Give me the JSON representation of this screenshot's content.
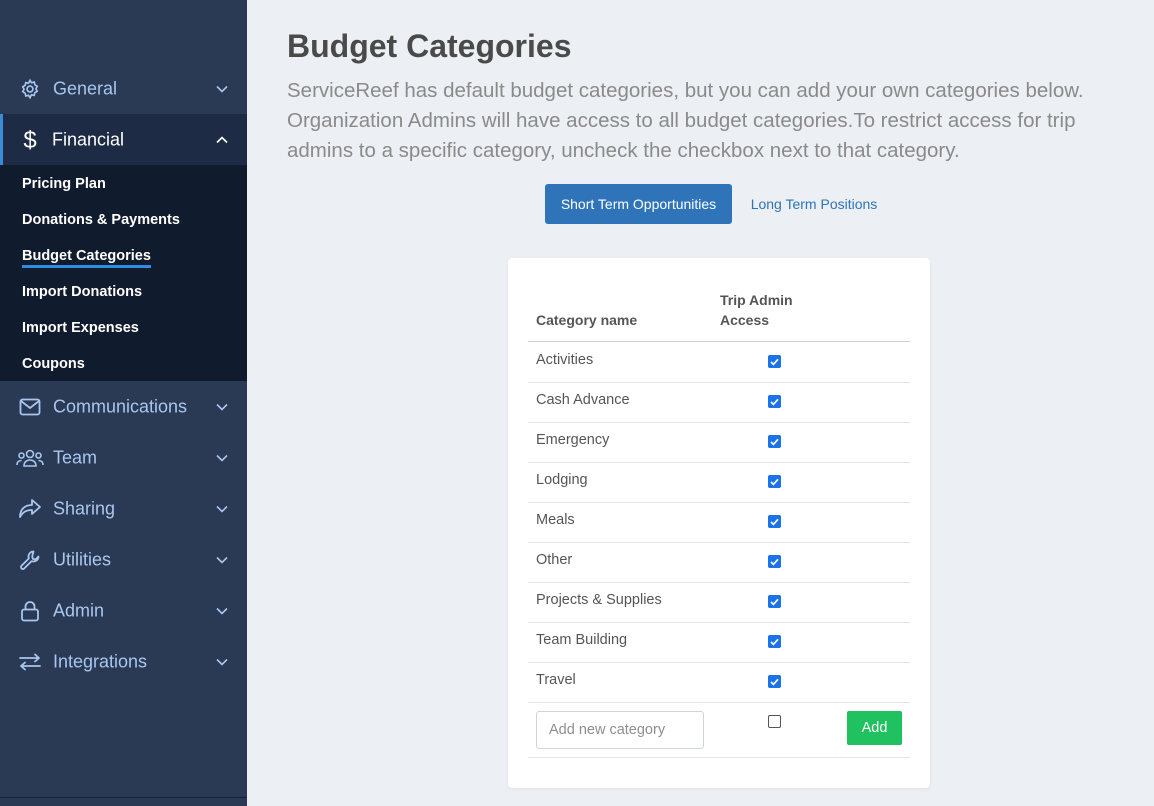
{
  "sidebar": {
    "nav": [
      {
        "key": "general",
        "label": "General",
        "icon": "gear-icon"
      },
      {
        "key": "financial",
        "label": "Financial",
        "icon": "dollar-icon"
      },
      {
        "key": "communications",
        "label": "Communications",
        "icon": "envelope-icon"
      },
      {
        "key": "team",
        "label": "Team",
        "icon": "users-icon"
      },
      {
        "key": "sharing",
        "label": "Sharing",
        "icon": "share-icon"
      },
      {
        "key": "utilities",
        "label": "Utilities",
        "icon": "wrench-icon"
      },
      {
        "key": "admin",
        "label": "Admin",
        "icon": "lock-icon"
      },
      {
        "key": "integrations",
        "label": "Integrations",
        "icon": "exchange-icon"
      }
    ],
    "financial_sub": [
      "Pricing Plan",
      "Donations & Payments",
      "Budget Categories",
      "Import Donations",
      "Import Expenses",
      "Coupons"
    ],
    "active_sub": "Budget Categories"
  },
  "main": {
    "title": "Budget Categories",
    "description": "ServiceReef has default budget categories, but you can add your own categories below. Organization Admins will have access to all budget categories.To restrict access for trip admins to a specific category, uncheck the checkbox next to that category.",
    "tabs": {
      "active": "Short Term Opportunities",
      "other": "Long Term Positions"
    },
    "table": {
      "col_category": "Category name",
      "col_access_line1": "Trip Admin",
      "col_access_line2": "Access",
      "rows": [
        {
          "name": "Activities",
          "access": true
        },
        {
          "name": "Cash Advance",
          "access": true
        },
        {
          "name": "Emergency",
          "access": true
        },
        {
          "name": "Lodging",
          "access": true
        },
        {
          "name": "Meals",
          "access": true
        },
        {
          "name": "Other",
          "access": true
        },
        {
          "name": "Projects & Supplies",
          "access": true
        },
        {
          "name": "Team Building",
          "access": true
        },
        {
          "name": "Travel",
          "access": true
        }
      ],
      "new_placeholder": "Add new category",
      "new_access": false,
      "add_label": "Add"
    }
  },
  "colors": {
    "accent": "#2f74b8",
    "add": "#1fc25e",
    "checkbox": "#1a73e8",
    "sidebar": "#2a3a55"
  }
}
